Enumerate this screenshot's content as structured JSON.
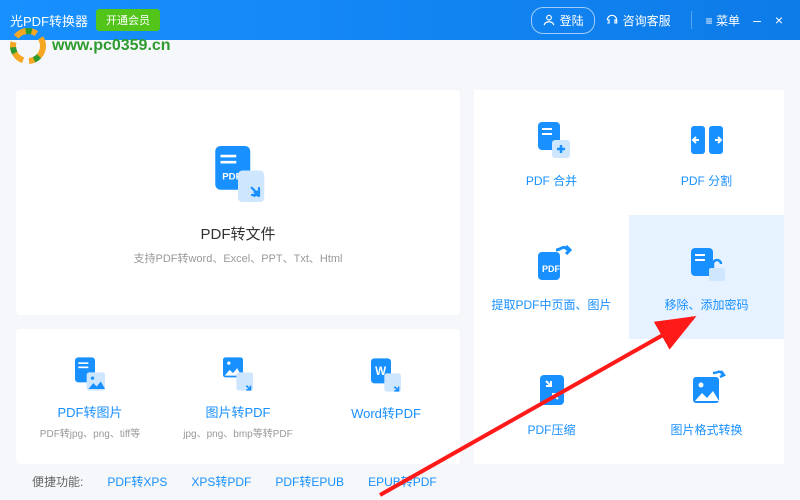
{
  "header": {
    "title": "光PDF转换器",
    "membership_btn": "开通会员",
    "login": "登陆",
    "support": "咨询客服",
    "menu": "≡ 菜单"
  },
  "watermark": {
    "url": "www.pc0359.cn"
  },
  "main_card": {
    "title": "PDF转文件",
    "subtitle": "支持PDF转word、Excel、PPT、Txt、Html"
  },
  "row3": [
    {
      "title": "PDF转图片",
      "sub": "PDF转jpg、png、tiff等"
    },
    {
      "title": "图片转PDF",
      "sub": "jpg、png、bmp等转PDF"
    },
    {
      "title": "Word转PDF",
      "sub": ""
    }
  ],
  "grid": [
    {
      "title": "PDF 合并",
      "highlight": false
    },
    {
      "title": "PDF 分割",
      "highlight": false
    },
    {
      "title": "提取PDF中页面、图片",
      "highlight": false
    },
    {
      "title": "移除、添加密码",
      "highlight": true
    },
    {
      "title": "PDF压缩",
      "highlight": false
    },
    {
      "title": "图片格式转换",
      "highlight": false
    }
  ],
  "footer": {
    "label": "便捷功能:",
    "links": [
      "PDF转XPS",
      "XPS转PDF",
      "PDF转EPUB",
      "EPUB转PDF"
    ]
  },
  "colors": {
    "primary": "#1890ff",
    "accent": "#52c41a"
  }
}
